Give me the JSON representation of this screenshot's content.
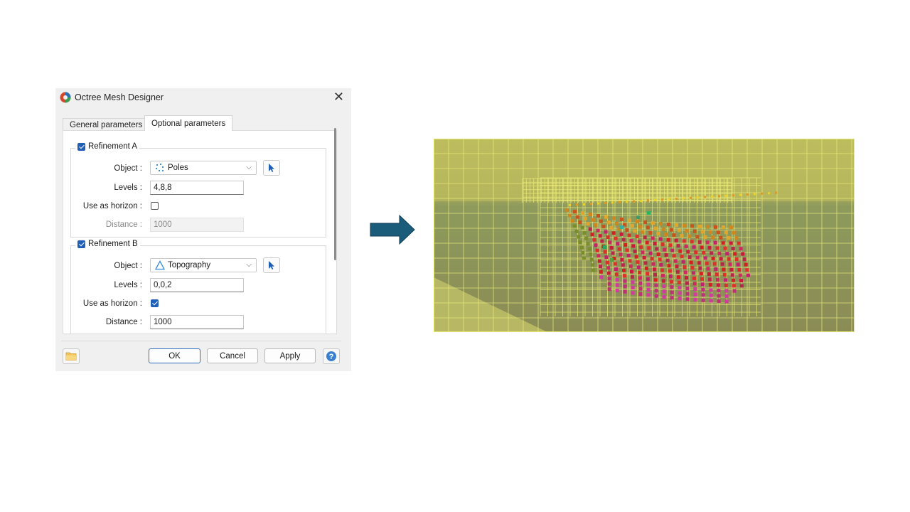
{
  "dialog": {
    "title": "Octree Mesh Designer",
    "close_icon": "close-icon",
    "tabs": [
      {
        "label": "General parameters",
        "active": false
      },
      {
        "label": "Optional parameters",
        "active": true
      }
    ],
    "refinement_a": {
      "label": "Refinement A",
      "enabled": true,
      "object_label": "Object :",
      "object_value": "Poles",
      "object_icon": "points-icon",
      "levels_label": "Levels :",
      "levels_value": "4,8,8",
      "horizon_label": "Use as horizon :",
      "horizon_checked": false,
      "distance_label": "Distance :",
      "distance_value": "1000",
      "distance_disabled": true
    },
    "refinement_b": {
      "label": "Refinement B",
      "enabled": true,
      "object_label": "Object :",
      "object_value": "Topography",
      "object_icon": "triangle-surface-icon",
      "levels_label": "Levels :",
      "levels_value": "0,0,2",
      "horizon_label": "Use as horizon :",
      "horizon_checked": true,
      "distance_label": "Distance :",
      "distance_value": "1000",
      "distance_disabled": false
    },
    "buttons": {
      "ok": "OK",
      "cancel": "Cancel",
      "apply": "Apply",
      "help_icon": "help-icon",
      "folder_icon": "folder-icon"
    }
  },
  "colors": {
    "accent": "#1f5fb5",
    "arrow": "#1b5c7a",
    "mesh_lines": "#ecec6a",
    "mesh_fill": "#a8a850"
  },
  "visualization": {
    "description_icon": "octree-mesh-view"
  }
}
